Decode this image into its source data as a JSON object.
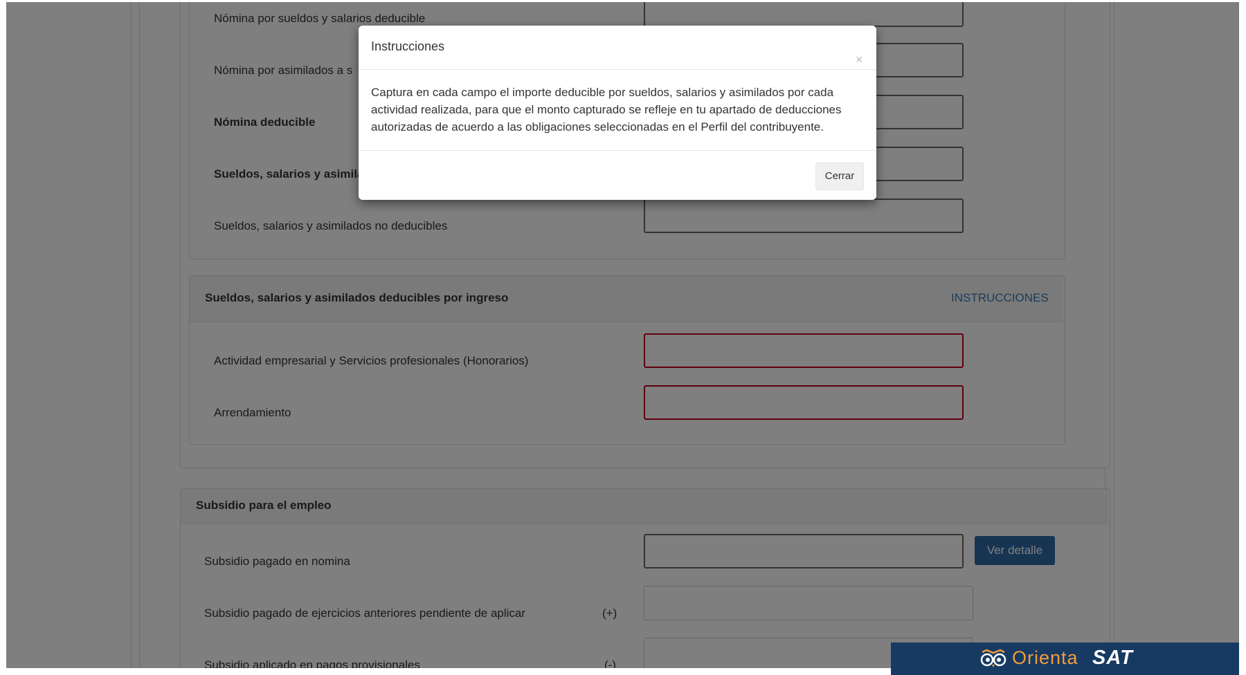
{
  "form": {
    "section1": {
      "rows": [
        {
          "label": "Nómina por sueldos y salarios deducible"
        },
        {
          "label": "Nómina por asimilados a s"
        },
        {
          "label": "Nómina deducible"
        },
        {
          "label": "Sueldos, salarios y asimila"
        },
        {
          "label": "Sueldos, salarios y asimilados no deducibles"
        }
      ]
    },
    "section2": {
      "title": "Sueldos, salarios y asimilados deducibles por ingreso",
      "instructions_link": "INSTRUCCIONES",
      "rows": [
        {
          "label": "Actividad empresarial y Servicios profesionales (Honorarios)"
        },
        {
          "label": "Arrendamiento"
        }
      ]
    },
    "section3": {
      "title": "Subsidio para el empleo",
      "ver_detalle_label": "Ver detalle",
      "rows": [
        {
          "label": "Subsidio pagado en nomina",
          "sign": ""
        },
        {
          "label": "Subsidio pagado de ejercicios anteriores pendiente de aplicar",
          "sign": "(+)"
        },
        {
          "label": "Subsidio aplicado en pagos provisionales",
          "sign": "(-)"
        }
      ]
    }
  },
  "modal": {
    "title": "Instrucciones",
    "close_symbol": "×",
    "body": "Captura en cada campo el importe deducible por sueldos, salarios y asimilados por cada actividad realizada, para que el monto capturado se refleje en tu apartado de deducciones autorizadas de acuerdo a las obligaciones seleccionadas en el Perfil del contribuyente.",
    "close_button": "Cerrar"
  },
  "brand": {
    "name_part1": "Orienta",
    "name_part2": "SAT"
  },
  "colors": {
    "link": "#337ab7",
    "primary_button": "#2e6aa6",
    "error_border": "#c0001a",
    "brand_bg": "#173a63",
    "brand_accent": "#f39c3c"
  }
}
